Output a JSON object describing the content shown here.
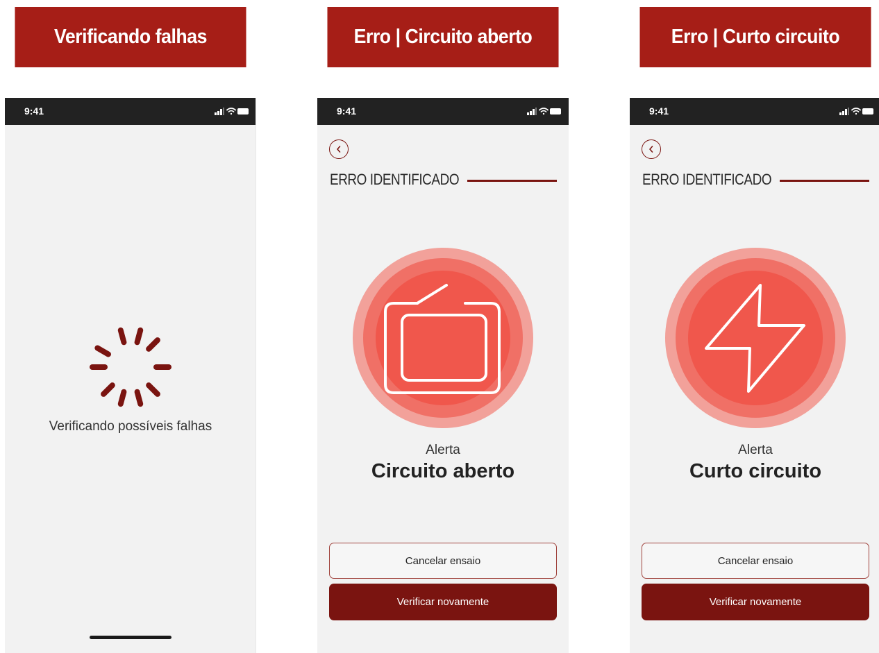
{
  "colors": {
    "banner": "#a61e17",
    "accent_dark": "#7a1410",
    "alert_outer": "#f2a19a",
    "alert_mid": "#f07066",
    "alert_inner": "#f0574c"
  },
  "screens": [
    {
      "banner_title": "Verificando falhas",
      "status_time": "9:41",
      "loading_text": "Verificando possíveis falhas"
    },
    {
      "banner_title": "Erro | Circuito aberto",
      "status_time": "9:41",
      "section_title": "ERRO IDENTIFICADO",
      "alert_icon": "open-circuit-icon",
      "alert_label": "Alerta",
      "alert_value": "Circuito aberto",
      "cancel_label": "Cancelar ensaio",
      "retry_label": "Verificar novamente"
    },
    {
      "banner_title": "Erro | Curto circuito",
      "status_time": "9:41",
      "section_title": "ERRO IDENTIFICADO",
      "alert_icon": "lightning-bolt-icon",
      "alert_label": "Alerta",
      "alert_value": "Curto circuito",
      "cancel_label": "Cancelar ensaio",
      "retry_label": "Verificar novamente"
    }
  ]
}
